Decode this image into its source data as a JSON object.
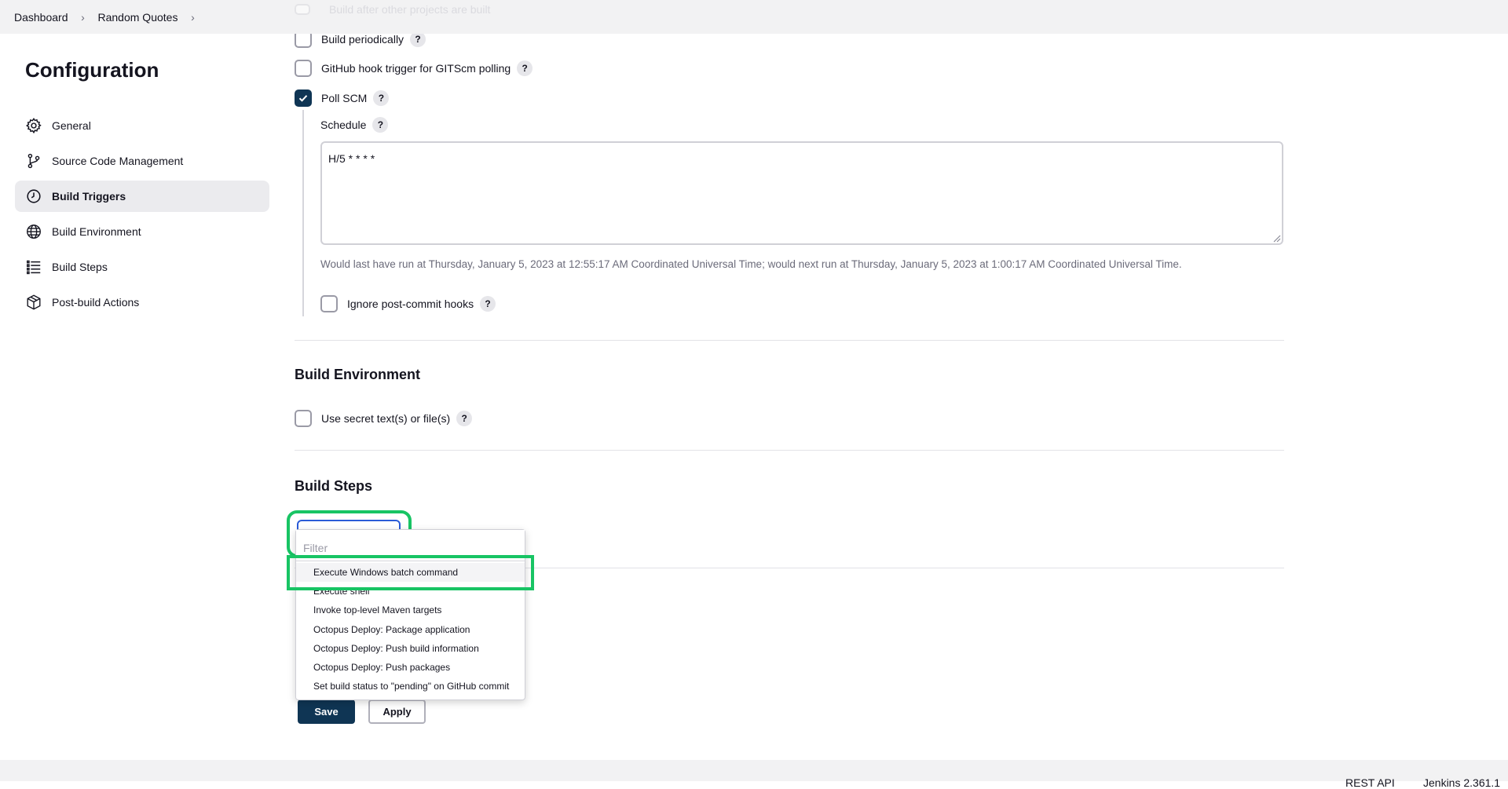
{
  "breadcrumb": {
    "items": [
      "Dashboard",
      "Random Quotes"
    ]
  },
  "page": {
    "title": "Configuration"
  },
  "sidebar": {
    "items": [
      {
        "label": "General",
        "icon": "gear-icon"
      },
      {
        "label": "Source Code Management",
        "icon": "branch-icon"
      },
      {
        "label": "Build Triggers",
        "icon": "clock-icon",
        "active": true
      },
      {
        "label": "Build Environment",
        "icon": "globe-icon"
      },
      {
        "label": "Build Steps",
        "icon": "list-icon"
      },
      {
        "label": "Post-build Actions",
        "icon": "cube-icon"
      }
    ]
  },
  "triggers": {
    "faded_label": "Build after other projects are built",
    "build_periodically": {
      "label": "Build periodically",
      "checked": false
    },
    "github_hook": {
      "label": "GitHub hook trigger for GITScm polling",
      "checked": false
    },
    "poll_scm": {
      "label": "Poll SCM",
      "checked": true
    },
    "schedule_label": "Schedule",
    "schedule_value": "H/5 * * * *",
    "schedule_hint": "Would last have run at Thursday, January 5, 2023 at 12:55:17 AM Coordinated Universal Time; would next run at Thursday, January 5, 2023 at 1:00:17 AM Coordinated Universal Time.",
    "ignore_hooks": {
      "label": "Ignore post-commit hooks",
      "checked": false
    }
  },
  "build_environment": {
    "title": "Build Environment",
    "secret": {
      "label": "Use secret text(s) or file(s)",
      "checked": false
    }
  },
  "build_steps": {
    "title": "Build Steps",
    "filter_placeholder": "Filter",
    "menu_items": [
      "Execute Windows batch command",
      "Execute shell",
      "Invoke top-level Maven targets",
      "Octopus Deploy: Package application",
      "Octopus Deploy: Push build information",
      "Octopus Deploy: Push packages",
      "Set build status to \"pending\" on GitHub commit"
    ]
  },
  "actions": {
    "save": "Save",
    "apply": "Apply"
  },
  "footer": {
    "rest_api": "REST API",
    "version": "Jenkins 2.361.1"
  },
  "help_glyph": "?",
  "colors": {
    "accent": "#0f3554",
    "highlight": "#18c464",
    "focus": "#2a5bd7"
  }
}
